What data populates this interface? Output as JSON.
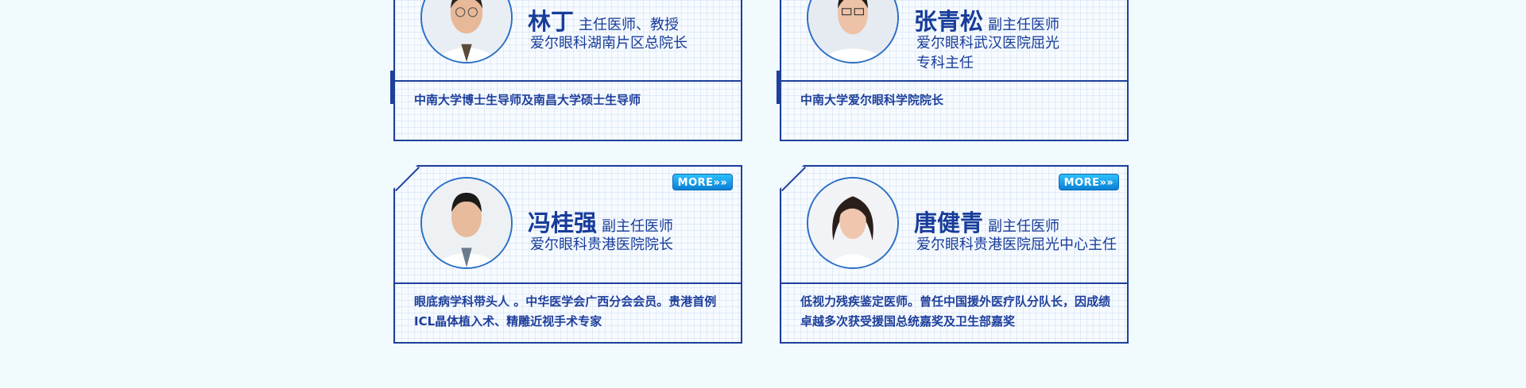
{
  "doctors": [
    {
      "name": "林丁",
      "title": "主任医师、教授",
      "role_lines": [
        "爱尔眼科湖南片区总院长"
      ],
      "description": "中南大学博士生导师及南昌大学硕士生导师"
    },
    {
      "name": "张青松",
      "title": "副主任医师",
      "role_lines": [
        "爱尔眼科武汉医院屈光",
        "专科主任"
      ],
      "description": "中南大学爱尔眼科学院院长"
    },
    {
      "name": "冯桂强",
      "title": "副主任医师",
      "role_lines": [
        "爱尔眼科贵港医院院长"
      ],
      "description": "眼底病学科带头人 。中华医学会广西分会会员。贵港首例ICL晶体植入术、精雕近视手术专家",
      "more_label": "MORE»»"
    },
    {
      "name": "唐健青",
      "title": "副主任医师",
      "role_lines": [
        "爱尔眼科贵港医院屈光中心主任"
      ],
      "description": "低视力残疾鉴定医师。曾任中国援外医疗队分队长，因成绩卓越多次获受援国总统嘉奖及卫生部嘉奖",
      "more_label": "MORE»»"
    }
  ],
  "colors": {
    "primary": "#1e3f9c",
    "text": "#173c9a",
    "background": "#f1fbfe",
    "more_button": "#0a7fd3"
  }
}
